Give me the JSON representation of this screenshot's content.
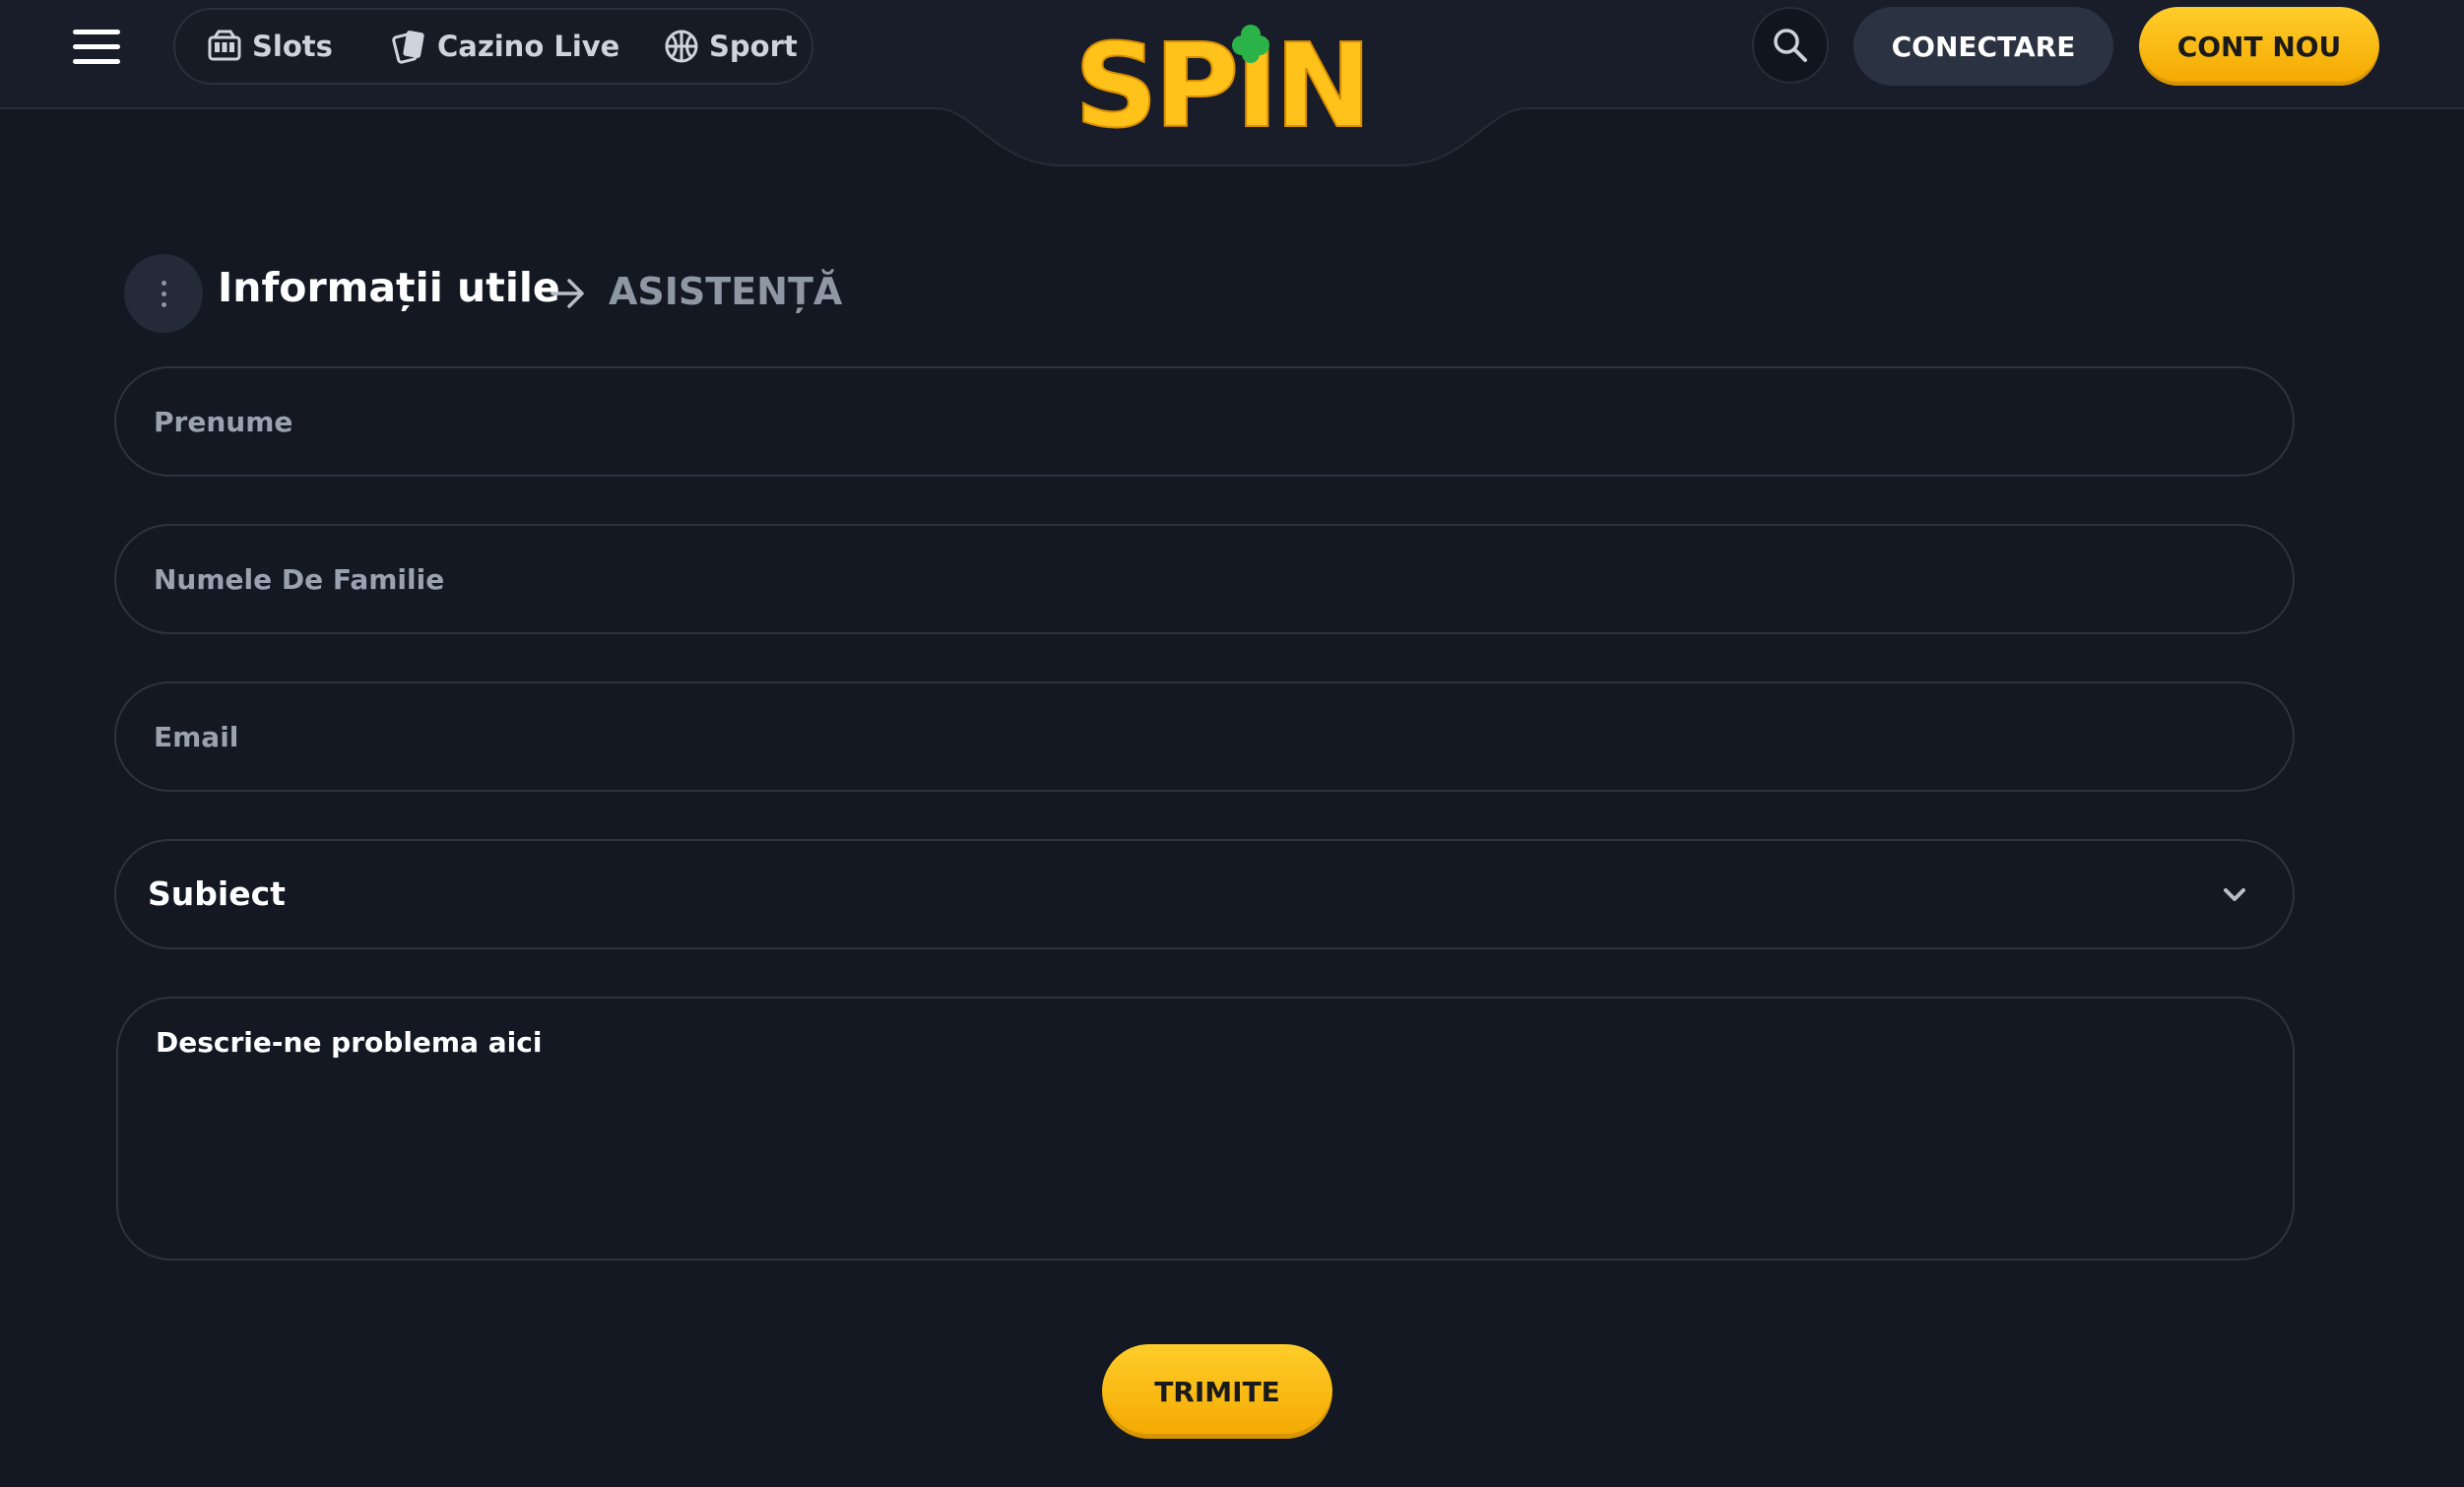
{
  "header": {
    "nav": [
      {
        "label": "Slots",
        "icon": "slot-machine-icon"
      },
      {
        "label": "Cazino Live",
        "icon": "playing-cards-icon"
      },
      {
        "label": "Sport",
        "icon": "basketball-icon"
      }
    ],
    "logo_text": "SPIN",
    "login_label": "CONECTARE",
    "register_label": "CONT NOU"
  },
  "breadcrumb": {
    "title": "Informații utile",
    "current": "ASISTENȚĂ"
  },
  "form": {
    "first_name_placeholder": "Prenume",
    "last_name_placeholder": "Numele De Familie",
    "email_placeholder": "Email",
    "subject_label": "Subiect",
    "message_placeholder": "Descrie-ne problema aici",
    "submit_label": "TRIMITE"
  },
  "colors": {
    "background": "#131822",
    "header": "#181d29",
    "accent_yellow": "#ffc21a",
    "logo_green": "#2bb34a",
    "muted_text": "#9aa1af"
  }
}
